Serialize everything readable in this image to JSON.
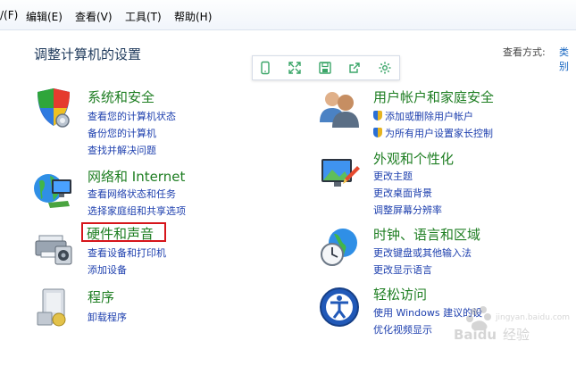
{
  "menu": {
    "items": [
      "/(F)",
      "编辑(E)",
      "查看(V)",
      "工具(T)",
      "帮助(H)"
    ]
  },
  "header": {
    "title": "调整计算机的设置",
    "view_by_label": "查看方式:",
    "view_by_value": "类别"
  },
  "toolbar": {
    "icons": [
      "phone-icon",
      "expand-icon",
      "save-icon",
      "share-icon",
      "gear-icon"
    ]
  },
  "categories": {
    "system": {
      "title": "系统和安全",
      "links": [
        "查看您的计算机状态",
        "备份您的计算机",
        "查找并解决问题"
      ]
    },
    "network": {
      "title": "网络和 Internet",
      "links": [
        "查看网络状态和任务",
        "选择家庭组和共享选项"
      ]
    },
    "hardware": {
      "title": "硬件和声音",
      "links": [
        "查看设备和打印机",
        "添加设备"
      ]
    },
    "programs": {
      "title": "程序",
      "links": [
        "卸载程序"
      ]
    },
    "users": {
      "title": "用户帐户和家庭安全",
      "links": [
        "添加或删除用户帐户",
        "为所有用户设置家长控制"
      ]
    },
    "appearance": {
      "title": "外观和个性化",
      "links": [
        "更改主题",
        "更改桌面背景",
        "调整屏幕分辨率"
      ]
    },
    "clock": {
      "title": "时钟、语言和区域",
      "links": [
        "更改键盘或其他输入法",
        "更改显示语言"
      ]
    },
    "access": {
      "title": "轻松访问",
      "links": [
        "使用 Windows 建议的设",
        "优化视频显示"
      ]
    }
  },
  "watermark": {
    "text": "Baidu 经验",
    "sub": "jingyan.baidu.com"
  },
  "colors": {
    "title_green": "#1e7e22",
    "link_blue": "#1d3fae",
    "highlight_red": "#d6151b"
  }
}
